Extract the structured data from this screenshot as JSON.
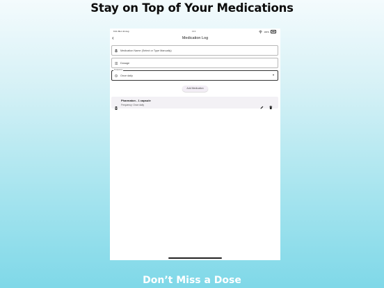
{
  "promo": {
    "headline": "Stay on Top of Your Medications",
    "footer": "Don’t Miss a Dose"
  },
  "statusbar": {
    "time": "9:41",
    "date": "Mon 11 Aug",
    "battery": "100%",
    "icons": [
      "wifi-icon",
      "battery-icon"
    ]
  },
  "appbar": {
    "back_glyph": "‹",
    "title": "Medication Log"
  },
  "form": {
    "name_placeholder": "Medication Name (Select or Type Manually)",
    "name_icon": "pill-bottle-icon",
    "dosage_placeholder": "Dosage",
    "dosage_icon": "list-icon",
    "frequency_label": "Frequency",
    "frequency_value": "Once daily",
    "frequency_icon": "clock-icon",
    "add_button": "Add Medication"
  },
  "medications": [
    {
      "name": "Pharmaton - 1 capsule",
      "frequency": "Frequency: Once daily",
      "icon": "pill-bottle-icon",
      "actions": [
        "edit-icon",
        "delete-icon"
      ]
    }
  ],
  "colors": {
    "accent_surface": "#f3eef6",
    "row_surface": "#f3f1f5",
    "bg_top": "#f4fbfd",
    "bg_bottom": "#7fd8e8"
  }
}
